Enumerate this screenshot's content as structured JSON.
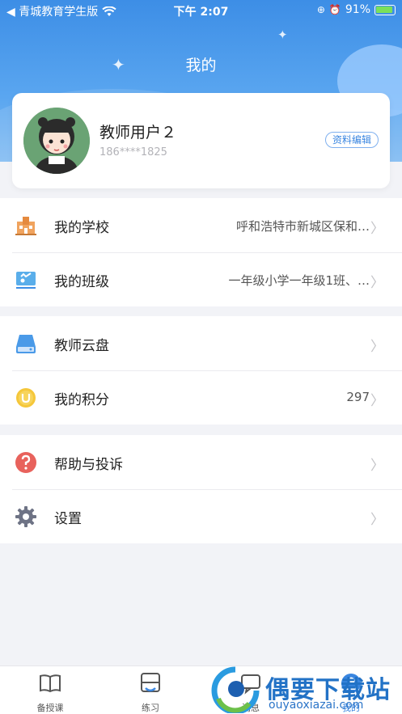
{
  "status_bar": {
    "carrier": "◀ 青城教育学生版",
    "time": "下午 2:07",
    "battery": "91%"
  },
  "header": {
    "title": "我的"
  },
  "profile": {
    "name": "教师用户２",
    "phone": "186****1825",
    "edit_label": "资料编辑"
  },
  "groups": [
    {
      "items": [
        {
          "icon": "school-icon",
          "label": "我的学校",
          "value": "呼和浩特市新城区保和…"
        },
        {
          "icon": "class-icon",
          "label": "我的班级",
          "value": "一年级小学一年级1班、…"
        }
      ]
    },
    {
      "items": [
        {
          "icon": "cloud-disk-icon",
          "label": "教师云盘",
          "value": ""
        },
        {
          "icon": "points-icon",
          "label": "我的积分",
          "value": "297"
        }
      ]
    },
    {
      "items": [
        {
          "icon": "help-icon",
          "label": "帮助与投诉",
          "value": ""
        },
        {
          "icon": "settings-gear-icon",
          "label": "设置",
          "value": ""
        }
      ]
    }
  ],
  "tabs": [
    {
      "icon": "book-icon",
      "label": "备授课"
    },
    {
      "icon": "exercise-icon",
      "label": "练习"
    },
    {
      "icon": "message-icon",
      "label": "消息"
    },
    {
      "icon": "profile-icon",
      "label": "我的"
    }
  ],
  "watermark": {
    "title": "偶要下载站",
    "url": "ouyaoxiazai.com"
  },
  "colors": {
    "primary": "#3a86e0",
    "header_top": "#3d8ee6",
    "background": "#f2f3f7"
  }
}
